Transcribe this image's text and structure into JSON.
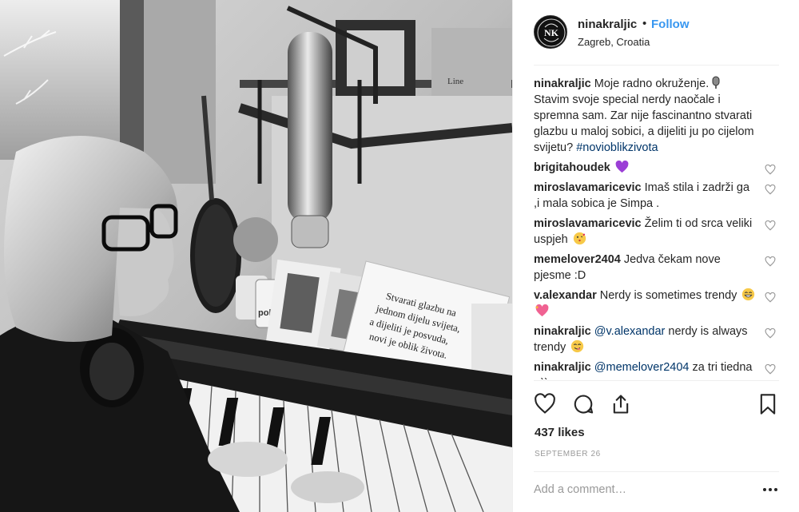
{
  "post": {
    "username": "ninakraljic",
    "separator": "•",
    "follow_label": "Follow",
    "location": "Zagreb, Croatia",
    "avatar_icon": "nk-monogram-icon"
  },
  "photo": {
    "card_text": [
      "Stvarati glazbu na",
      "jednom dijelu svijeta,",
      "a dijeliti je posvuda,",
      "novi je oblik života."
    ],
    "mug_text": "polsiv",
    "frame_text": "Line"
  },
  "comments": [
    {
      "user": "ninakraljic",
      "text": "Moje radno okruženje.",
      "text2": "Stavim svoje special nerdy naočale i spremna sam. Zar nije fascinantno stvarati glazbu u maloj sobici, a dijeliti ju po cijelom svijetu?",
      "hashtag": "#novioblikzivota",
      "emoji": "microphone-emoji"
    },
    {
      "user": "brigitahoudek",
      "text": "",
      "emoji": "purple-heart-emoji"
    },
    {
      "user": "miroslavamaricevic",
      "text": "Imaš stila i zadrži ga ,i mala sobica je Simpa ."
    },
    {
      "user": "miroslavamaricevic",
      "text": "Želim ti od srca veliki uspjeh",
      "emoji": "kissing-face-emoji"
    },
    {
      "user": "memelover2404",
      "text": "Jedva čekam nove pjesme :D"
    },
    {
      "user": "v.alexandar",
      "text": "Nerdy is sometimes trendy",
      "emoji": "grin-emoji, sparkling-heart-emoji"
    },
    {
      "user": "ninakraljic",
      "mention": "@v.alexandar",
      "text": "nerdy is always trendy",
      "emoji": "yum-face-emoji"
    },
    {
      "user": "ninakraljic",
      "mention": "@memelover2404",
      "text": "za tri tiedna :-))"
    }
  ],
  "actions": {
    "like_icon": "heart-icon",
    "comment_icon": "comment-icon",
    "share_icon": "share-icon",
    "save_icon": "bookmark-icon"
  },
  "likes": "437 likes",
  "date": "SEPTEMBER 26",
  "comment_input": {
    "placeholder": "Add a comment…"
  },
  "more_icon": "more-options-icon",
  "colors": {
    "link": "#3897f0",
    "hashtag": "#003569",
    "text": "#262626",
    "muted": "#999999"
  }
}
